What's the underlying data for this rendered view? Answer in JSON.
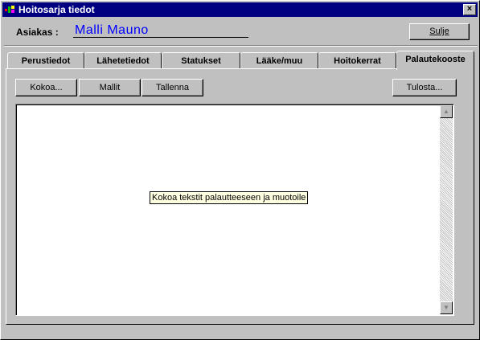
{
  "window": {
    "title": "Hoitosarja tiedot",
    "close_glyph": "×"
  },
  "customer": {
    "label": "Asiakas :",
    "name": "Malli Mauno"
  },
  "close_button": {
    "label": "Sulje"
  },
  "tabs": [
    {
      "label": "Perustiedot",
      "active": false
    },
    {
      "label": "Lähetetiedot",
      "active": false
    },
    {
      "label": "Statukset",
      "active": false
    },
    {
      "label": "Lääke/muu",
      "active": false
    },
    {
      "label": "Hoitokerrat",
      "active": false
    },
    {
      "label": "Palautekooste",
      "active": true
    }
  ],
  "toolbar": {
    "collect_label": "Kokoa...",
    "templates_label": "Mallit",
    "save_label": "Tallenna",
    "print_label": "Tulosta..."
  },
  "editor": {
    "content": ""
  },
  "tooltip": {
    "text": "Kokoa tekstit palautteeseen ja muotoile"
  }
}
